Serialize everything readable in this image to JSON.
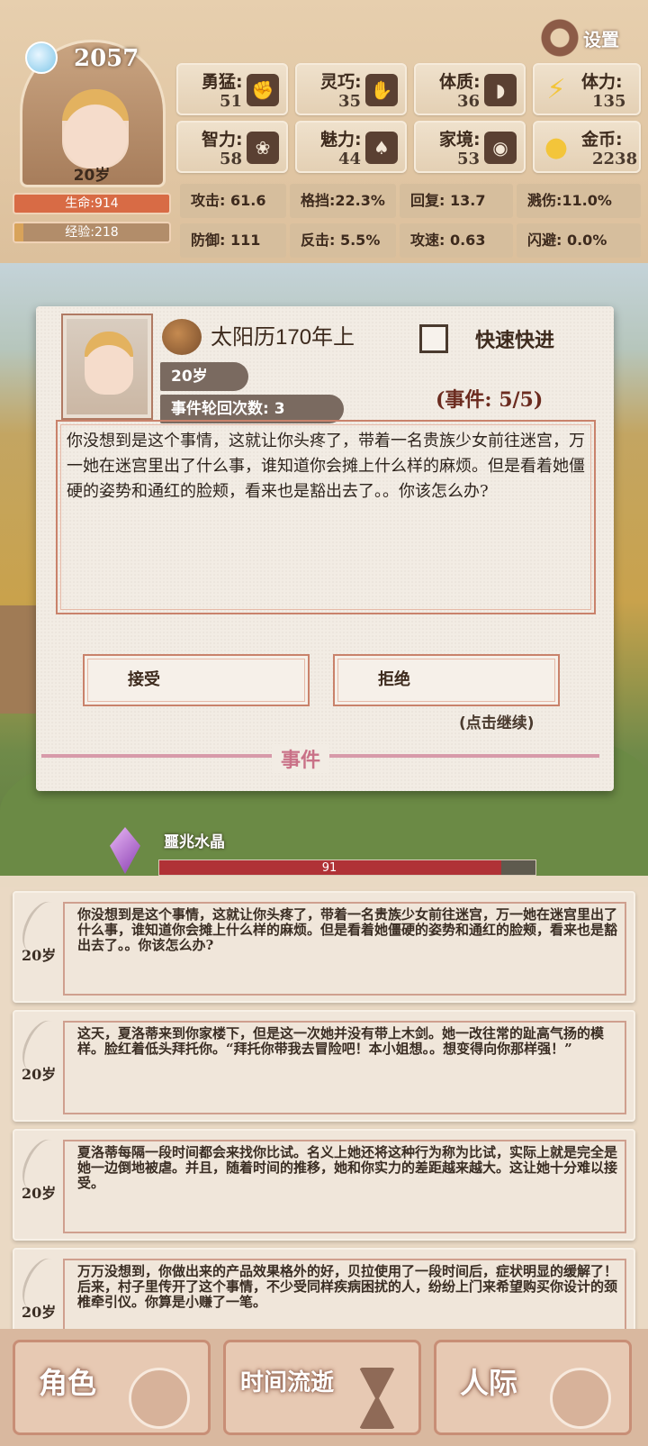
{
  "header": {
    "soul_value": "2057",
    "age": "20岁",
    "hp": "生命:914",
    "xp": "经验:218",
    "xp_progress": 0.06,
    "settings": "设置"
  },
  "attributes": [
    {
      "label": "勇猛:",
      "value": "51",
      "icon": "fist-icon"
    },
    {
      "label": "灵巧:",
      "value": "35",
      "icon": "hand-icon"
    },
    {
      "label": "体质:",
      "value": "36",
      "icon": "arm-icon"
    },
    {
      "label": "智力:",
      "value": "58",
      "icon": "brain-icon"
    },
    {
      "label": "魅力:",
      "value": "44",
      "icon": "lotus-icon"
    },
    {
      "label": "家境:",
      "value": "53",
      "icon": "coin-hand-icon"
    }
  ],
  "resources": [
    {
      "label": "体力:",
      "value": "135",
      "icon": "lightning-icon"
    },
    {
      "label": "金币:",
      "value": "2238",
      "icon": "gold-coin-icon"
    }
  ],
  "combat": [
    {
      "text": "攻击: 61.6"
    },
    {
      "text": "格挡:22.3%"
    },
    {
      "text": "回复:  13.7"
    },
    {
      "text": "溅伤:11.0%"
    },
    {
      "text": "防御:  111"
    },
    {
      "text": "反击: 5.5%"
    },
    {
      "text": "攻速:  0.63"
    },
    {
      "text": "闪避:  0.0%"
    }
  ],
  "event": {
    "date": "太阳历170年上",
    "fast_forward": "快速快进",
    "age": "20岁",
    "rounds": "事件轮回次数: 3",
    "count": "(事件: 5/5)",
    "text": "你没想到是这个事情，这就让你头疼了，带着一名贵族少女前往迷宫，万一她在迷宫里出了什么事，谁知道你会摊上什么样的麻烦。但是看着她僵硬的姿势和通红的脸颊，看来也是豁出去了。。你该怎么办?",
    "accept": "接受",
    "reject": "拒绝",
    "continue": "(点击继续)",
    "banner": "事件"
  },
  "crystal": {
    "label": "噩兆水晶",
    "value": "91",
    "progress": 0.91
  },
  "log": [
    {
      "age": "20岁",
      "text": "你没想到是这个事情，这就让你头疼了，带着一名贵族少女前往迷宫，万一她在迷宫里出了什么事，谁知道你会摊上什么样的麻烦。但是看着她僵硬的姿势和通红的脸颊，看来也是豁出去了。。你该怎么办?"
    },
    {
      "age": "20岁",
      "text": "这天，夏洛蒂来到你家楼下，但是这一次她并没有带上木剑。她一改往常的趾高气扬的模样。脸红着低头拜托你。“拜托你带我去冒险吧！本小姐想。。想变得向你那样强！”"
    },
    {
      "age": "20岁",
      "text": "夏洛蒂每隔一段时间都会来找你比试。名义上她还将这种行为称为比试，实际上就是完全是她一边倒地被虐。并且，随着时间的推移，她和你实力的差距越来越大。这让她十分难以接受。"
    },
    {
      "age": "20岁",
      "text": "万万没想到，你做出来的产品效果格外的好，贝拉使用了一段时间后，症状明显的缓解了！后来，村子里传开了这个事情，不少受同样疾病困扰的人，纷纷上门来希望购买你设计的颈椎牵引仪。你算是小赚了一笔。"
    }
  ],
  "nav": {
    "role": "角色",
    "time": "时间流逝",
    "social": "人际"
  },
  "colors": {
    "hp": "#d86b45",
    "crystal_bar": "#b03236",
    "event_accent": "#c97187"
  }
}
